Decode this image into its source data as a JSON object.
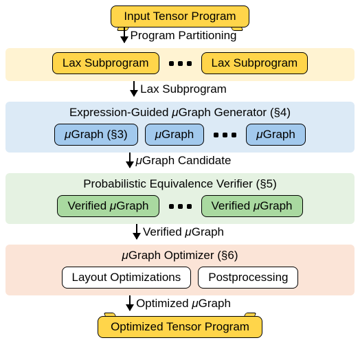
{
  "top_box": "Input Tensor Program",
  "arrows": {
    "a1": "Program Partitioning",
    "a2": "Lax Subprogram",
    "a3": "Graph Candidate",
    "a4": "Verified ",
    "a4_suffix": "Graph",
    "a5": "Optimized ",
    "a5_suffix": "Graph"
  },
  "band1": {
    "left": "Lax Subprogram",
    "right": "Lax Subprogram"
  },
  "band2": {
    "title_prefix": "Expression-Guided ",
    "title_suffix": "Graph Generator (§4)",
    "box1_suffix": "Graph (§3)",
    "box2_suffix": "Graph",
    "box3_suffix": "Graph"
  },
  "band3": {
    "title": "Probabilistic Equivalence Verifier (§5)",
    "box_prefix": "Verified ",
    "box_suffix": "Graph"
  },
  "band4": {
    "title_suffix": "Graph Optimizer (§6)",
    "left": "Layout Optimizations",
    "right": "Postprocessing"
  },
  "bottom_box": "Optimized Tensor Program",
  "mu": "μ"
}
